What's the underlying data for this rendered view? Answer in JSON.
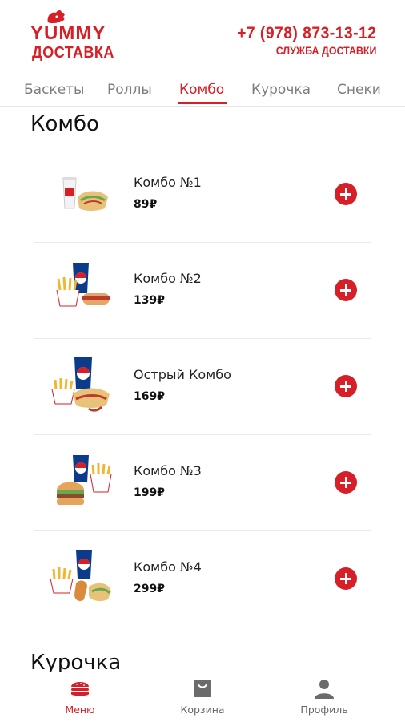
{
  "header": {
    "logo_top": "YUMMY",
    "logo_bottom": "ДОСТАВКА",
    "phone": "+7 (978) 873-13-12",
    "service": "СЛУЖБА ДОСТАВКИ"
  },
  "tabs": [
    {
      "label": "Баскеты",
      "active": false
    },
    {
      "label": "Роллы",
      "active": false
    },
    {
      "label": "Комбо",
      "active": true
    },
    {
      "label": "Курочка",
      "active": false
    },
    {
      "label": "Снеки",
      "active": false
    }
  ],
  "section_title": "Комбо",
  "next_section_title": "Курочка",
  "items": [
    {
      "name": "Комбо №1",
      "price": "89₽"
    },
    {
      "name": "Комбо №2",
      "price": "139₽"
    },
    {
      "name": "Острый Комбо",
      "price": "169₽"
    },
    {
      "name": "Комбо №3",
      "price": "199₽"
    },
    {
      "name": "Комбо №4",
      "price": "299₽"
    }
  ],
  "bottom_nav": [
    {
      "label": "Меню",
      "icon": "burger-icon",
      "active": true
    },
    {
      "label": "Корзина",
      "icon": "cart-bag-icon",
      "active": false
    },
    {
      "label": "Профиль",
      "icon": "profile-icon",
      "active": false
    }
  ],
  "colors": {
    "accent": "#d61f26",
    "inactive": "#7d7d7d"
  }
}
